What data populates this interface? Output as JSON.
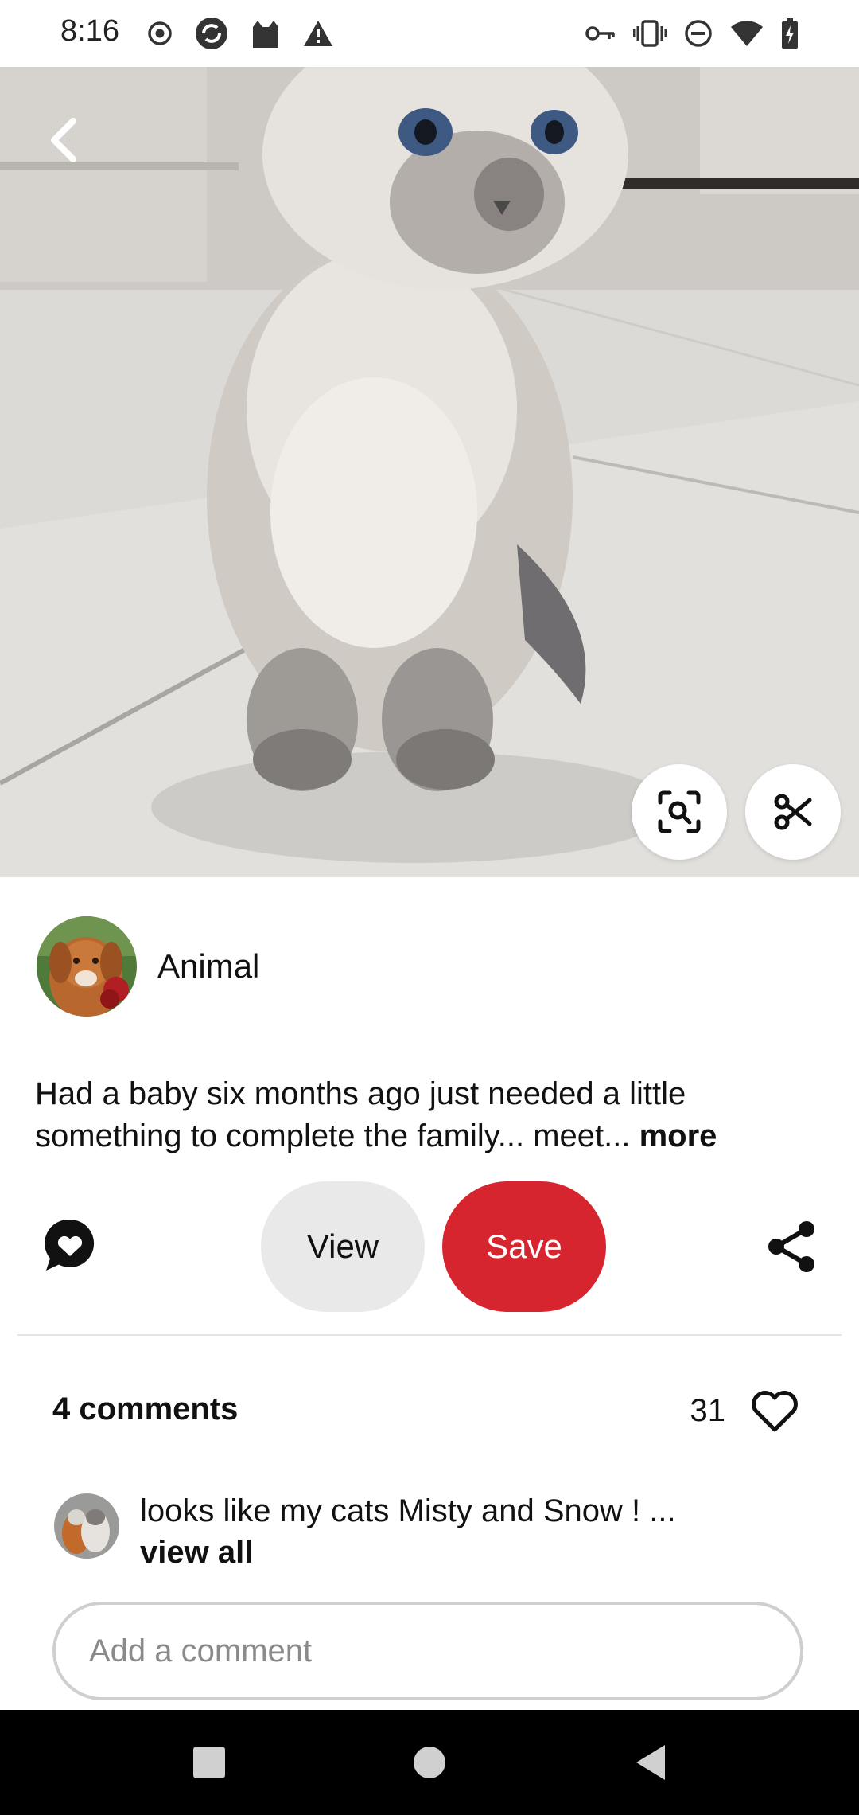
{
  "status_bar": {
    "time": "8:16",
    "left_icons": [
      "record-icon",
      "sync-icon",
      "cat-icon",
      "warning-icon"
    ],
    "right_icons": [
      "key-icon",
      "vibrate-icon",
      "dnd-icon",
      "wifi-icon",
      "battery-charging-icon"
    ]
  },
  "pin": {
    "image_subject": "grey and white kitten sitting on tile floor",
    "creator": {
      "name": "Animal",
      "avatar": "dog-with-rose-avatar"
    },
    "description": "Had a baby six months ago just needed a little something to complete the family... meet...",
    "more_label": "more"
  },
  "actions": {
    "view_label": "View",
    "save_label": "Save",
    "save_color": "#d7252f",
    "view_color": "#e9e9e9"
  },
  "comments": {
    "count_label": "4 comments",
    "likes_count": "31",
    "preview": {
      "text": "looks like my cats Misty and Snow ! ...",
      "view_all_label": "view all"
    },
    "input_placeholder": "Add a comment"
  }
}
